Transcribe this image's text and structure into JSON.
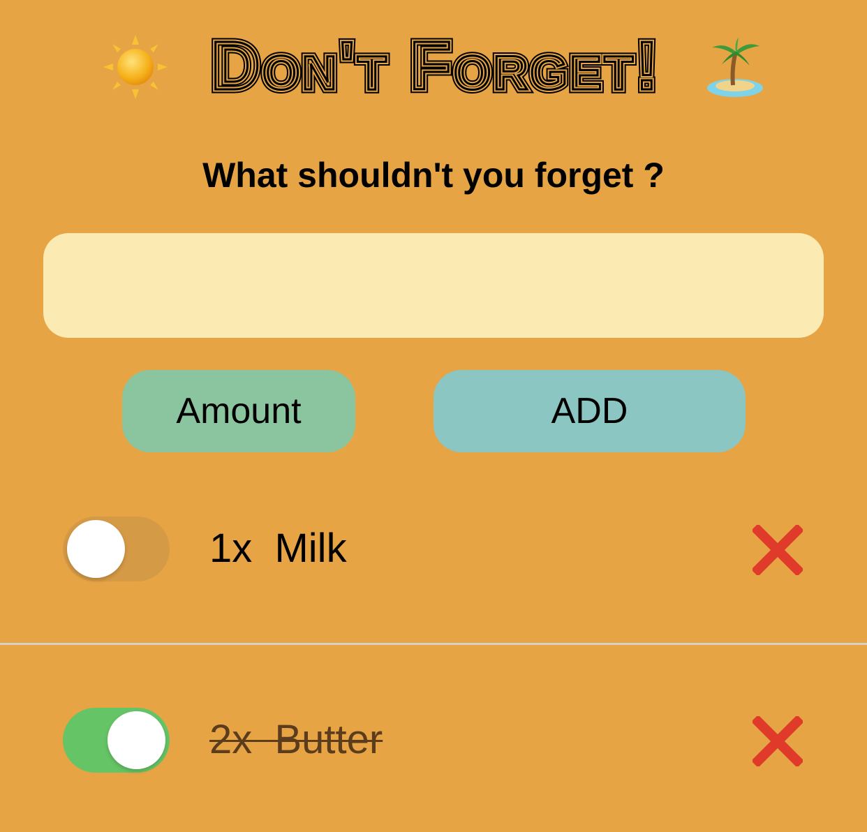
{
  "app": {
    "title": "Don't Forget!",
    "title_icon_left": "sun-icon",
    "title_icon_right": "desert-island-icon"
  },
  "prompt": "What shouldn't you forget ?",
  "input": {
    "value": "",
    "placeholder": ""
  },
  "buttons": {
    "amount_label": "Amount",
    "add_label": "ADD"
  },
  "items": [
    {
      "quantity": "1x",
      "name": "Milk",
      "label": "1x  Milk",
      "checked": false,
      "delete_icon": "red-x-icon"
    },
    {
      "quantity": "2x",
      "name": "Butter",
      "label": "2x  Butter",
      "checked": true,
      "delete_icon": "red-x-icon"
    }
  ],
  "colors": {
    "background": "#E6A444",
    "input_background": "#FCEAB3",
    "amount_button": "#8BC5A0",
    "add_button": "#8BC6C2",
    "toggle_on": "#65C466",
    "toggle_off": "#D59A46",
    "delete_red": "#E03A2A"
  }
}
